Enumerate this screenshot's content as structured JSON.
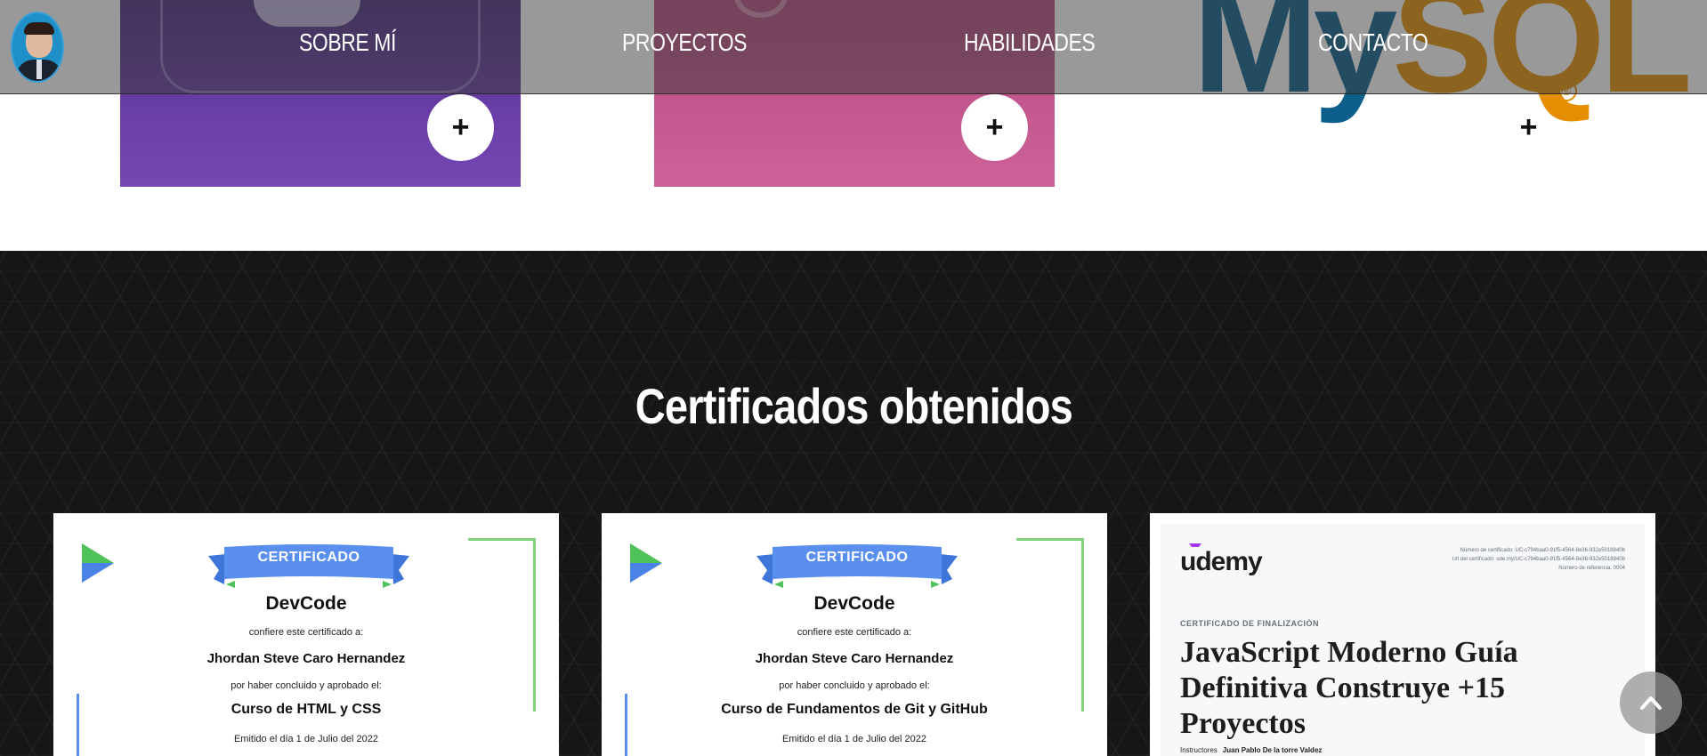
{
  "nav": {
    "avatar_alt": "Foto de perfil",
    "links": [
      "SOBRE MÍ",
      "PROYECTOS",
      "HABILIDADES",
      "CONTACTO"
    ]
  },
  "skills": {
    "mysql_logo_my": "My",
    "mysql_logo_sql": "SQL",
    "mysql_reg": "®",
    "plus_symbol": "+"
  },
  "certificates": {
    "title": "Certificados obtenidos",
    "items": [
      {
        "issuer": "DevCode",
        "ribbon": "CERTIFICADO",
        "confers": "confiere este certificado a:",
        "person": "Jhordan Steve Caro Hernandez",
        "completed": "por haber concluido y aprobado el:",
        "course": "Curso de HTML y CSS",
        "issued": "Emitido el día 1 de Julio del 2022"
      },
      {
        "issuer": "DevCode",
        "ribbon": "CERTIFICADO",
        "confers": "confiere este certificado a:",
        "person": "Jhordan Steve Caro Hernandez",
        "completed": "por haber concluido y aprobado el:",
        "course": "Curso de Fundamentos de Git y GitHub",
        "issued": "Emitido el día 1 de Julio del 2022"
      },
      {
        "issuer": "udemy",
        "meta_lines": [
          "Número de certificado: UC-c794baa0-91f5-4564-8e36-932e5018840b",
          "Url del certificado: ude.my/UC-c794baa0-91f5-4564-8e36-932e5018840b",
          "Número de referencia: 0004"
        ],
        "kicker": "CERTIFICADO DE FINALIZACIÓN",
        "course": "JavaScript Moderno Guía Definitiva Construye +15 Proyectos",
        "instructors_label": "Instructores",
        "instructor": "Juan Pablo De la torre Valdez"
      }
    ]
  },
  "colors": {
    "nav_bg": "#3c3c3c",
    "card_purple": "#6a3ea8",
    "card_pink": "#cc6297",
    "section_dark": "#161616",
    "ribbon_blue": "#5a8ff0",
    "frame_green": "#7fd17a",
    "mysql_blue": "#0b5f8a",
    "mysql_orange": "#e48e00",
    "udemy_purple": "#a435f0"
  },
  "icons": {
    "scroll_top": "chevron-up-icon",
    "devcode_logo": "devcode-play-logo-icon"
  }
}
